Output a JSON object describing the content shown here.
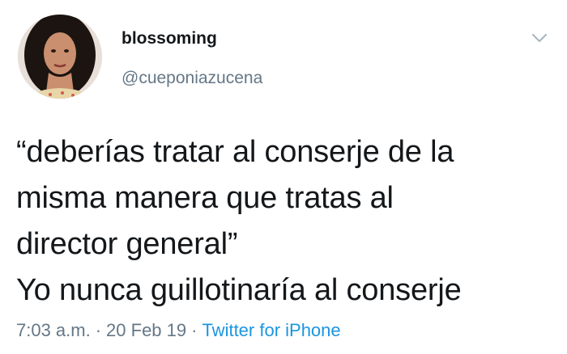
{
  "user": {
    "display_name": "blossoming",
    "handle": "@cueponiazucena"
  },
  "tweet": {
    "text": "“deberías tratar al conserje de la\nmisma manera que tratas al\ndirector general”\nYo nunca guillotinaría al conserje"
  },
  "meta": {
    "time": "7:03 a.m.",
    "separator": "·",
    "date": "20 Feb 19",
    "source": "Twitter for iPhone"
  },
  "icons": {
    "menu": "chevron-down-icon",
    "avatar": "profile-avatar"
  },
  "colors": {
    "text": "#14171a",
    "secondary": "#657786",
    "link": "#1b95e0",
    "background": "#ffffff"
  }
}
